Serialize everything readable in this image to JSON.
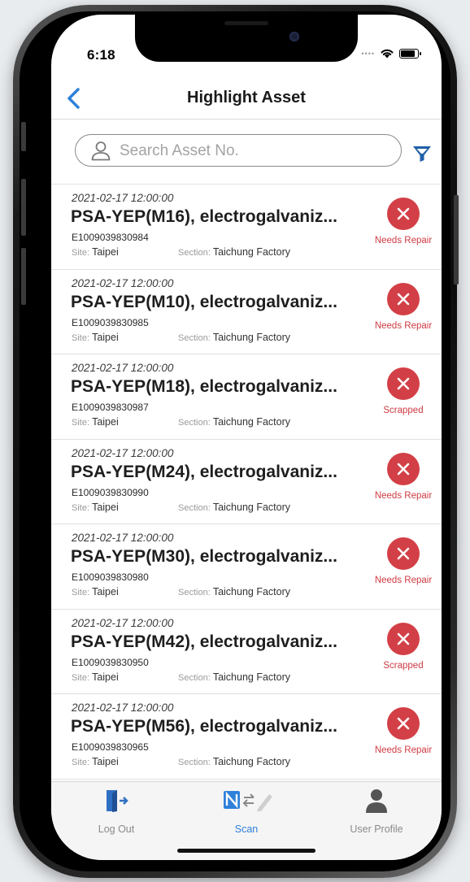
{
  "status_bar": {
    "time": "6:18"
  },
  "header": {
    "title": "Highlight Asset"
  },
  "search": {
    "placeholder": "Search Asset No."
  },
  "labels": {
    "site": "Site: ",
    "section": "Section: "
  },
  "assets": [
    {
      "date": "2021-02-17 12:00:00",
      "name": "PSA-YEP(M16), electrogalvaniz...",
      "asset_no": "E1009039830984",
      "site": "Taipei",
      "section": "Taichung Factory",
      "status": "Needs Repair"
    },
    {
      "date": "2021-02-17 12:00:00",
      "name": "PSA-YEP(M10), electrogalvaniz...",
      "asset_no": "E1009039830985",
      "site": "Taipei",
      "section": "Taichung Factory",
      "status": "Needs Repair"
    },
    {
      "date": "2021-02-17 12:00:00",
      "name": "PSA-YEP(M18), electrogalvaniz...",
      "asset_no": "E1009039830987",
      "site": "Taipei",
      "section": "Taichung Factory",
      "status": "Scrapped"
    },
    {
      "date": "2021-02-17 12:00:00",
      "name": "PSA-YEP(M24), electrogalvaniz...",
      "asset_no": "E1009039830990",
      "site": "Taipei",
      "section": "Taichung Factory",
      "status": "Needs Repair"
    },
    {
      "date": "2021-02-17 12:00:00",
      "name": "PSA-YEP(M30), electrogalvaniz...",
      "asset_no": "E1009039830980",
      "site": "Taipei",
      "section": "Taichung Factory",
      "status": "Needs Repair"
    },
    {
      "date": "2021-02-17 12:00:00",
      "name": "PSA-YEP(M42), electrogalvaniz...",
      "asset_no": "E1009039830950",
      "site": "Taipei",
      "section": "Taichung Factory",
      "status": "Scrapped"
    },
    {
      "date": "2021-02-17 12:00:00",
      "name": "PSA-YEP(M56), electrogalvaniz...",
      "asset_no": "E1009039830965",
      "site": "Taipei",
      "section": "Taichung Factory",
      "status": "Needs Repair"
    }
  ],
  "tab_bar": {
    "tabs": [
      {
        "label": "Log Out",
        "icon": "logout-icon",
        "active": false
      },
      {
        "label": "Scan",
        "icon": "nfc-scan-icon",
        "active": true
      },
      {
        "label": "User Profile",
        "icon": "user-profile-icon",
        "active": false
      }
    ]
  },
  "colors": {
    "accent": "#2f80d9",
    "danger": "#d33f46",
    "filter": "#1f5fa8"
  }
}
